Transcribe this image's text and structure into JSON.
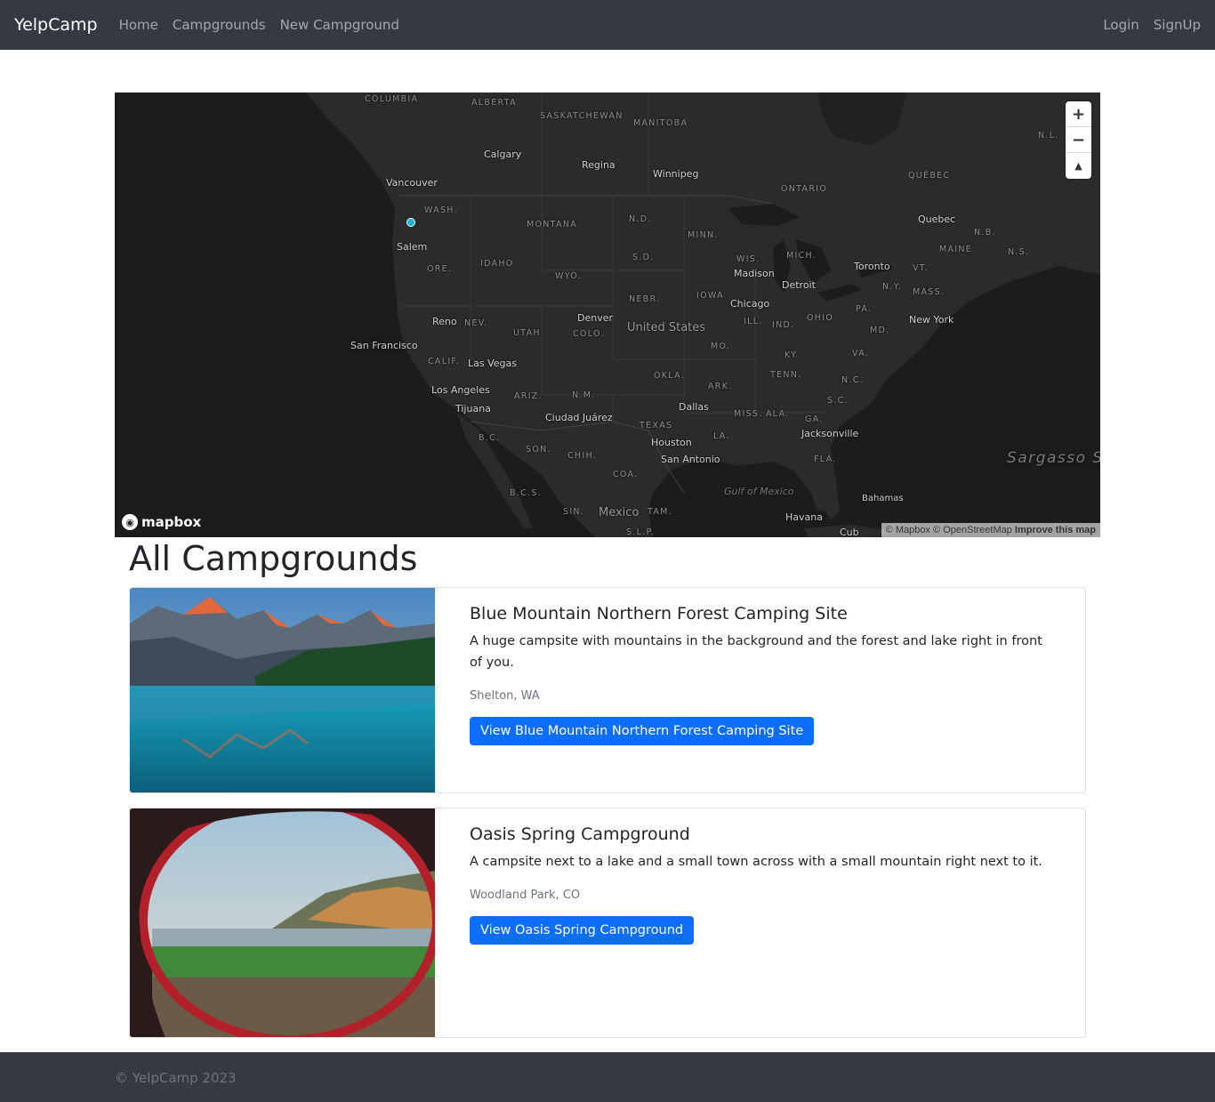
{
  "navbar": {
    "brand": "YelpCamp",
    "links": [
      "Home",
      "Campgrounds",
      "New Campground"
    ],
    "auth": [
      "Login",
      "SignUp"
    ]
  },
  "map": {
    "controls": {
      "zoom_in": "+",
      "zoom_out": "−",
      "compass": "▲"
    },
    "logo": "mapbox",
    "attribution": {
      "text": "© Mapbox © OpenStreetMap",
      "improve": "Improve this map"
    },
    "marker_color": "#11b4da",
    "labels": {
      "columbia": "COLUMBIA",
      "alberta": "ALBERTA",
      "saskatchewan": "SASKATCHEWAN",
      "manitoba": "MANITOBA",
      "calgary": "Calgary",
      "regina": "Regina",
      "winnipeg": "Winnipeg",
      "ontario": "ONTARIO",
      "quebec_prov": "QUÉBEC",
      "nl": "N.L.",
      "vancouver": "Vancouver",
      "wash": "WASH.",
      "montana": "MONTANA",
      "nd": "N.D.",
      "minn": "MINN.",
      "quebec": "Quebec",
      "nb": "N.B.",
      "salem": "Salem",
      "idaho": "IDAHO",
      "ore": "ORE.",
      "sd": "S.D.",
      "wis": "WIS.",
      "mich": "MICH.",
      "maine": "MAINE",
      "ns": "N.S.",
      "wyo": "WYO.",
      "madison": "Madison",
      "toronto": "Toronto",
      "vt": "VT.",
      "detroit": "Detroit",
      "ny": "N.Y.",
      "mass": "MASS.",
      "nebr": "NEBR.",
      "iowa": "IOWA",
      "chicago": "Chicago",
      "pa": "PA.",
      "denver": "Denver",
      "reno": "Reno",
      "nev": "NEV.",
      "ohio": "OHIO",
      "new_york": "New York",
      "utah": "UTAH",
      "colo": "COLO.",
      "united_states": "United States",
      "ill": "ILL.",
      "ind": "IND.",
      "md": "MD.",
      "san_francisco": "San Francisco",
      "mo": "MO.",
      "calif": "CALIF.",
      "las_vegas": "Las Vegas",
      "ky": "KY.",
      "va": "VA.",
      "okla": "OKLA.",
      "tenn": "TENN.",
      "los_angeles": "Los Angeles",
      "ariz": "ARIZ.",
      "nm": "N.M.",
      "ark": "ARK.",
      "nc": "N.C.",
      "tijuana": "Tijuana",
      "dallas": "Dallas",
      "sc": "S.C.",
      "miss": "MISS.",
      "ala": "ALA.",
      "ciudad_juarez": "Ciudad Juárez",
      "ga": "GA.",
      "texas": "TEXAS",
      "bc": "B.C.",
      "la": "LA.",
      "jacksonville": "Jacksonville",
      "houston": "Houston",
      "son": "SON.",
      "sargasso": "Sargasso Sea",
      "chih": "CHIH.",
      "san_antonio": "San Antonio",
      "fla": "FLA.",
      "coa": "COA.",
      "gulf": "Gulf of Mexico",
      "bcs": "B.C.S.",
      "bahamas": "Bahamas",
      "sin": "SIN.",
      "mexico": "Mexico",
      "tam": "TAM.",
      "havana": "Havana",
      "slp": "S.L.P.",
      "cuba": "Cub"
    }
  },
  "page": {
    "title": "All Campgrounds"
  },
  "campgrounds": [
    {
      "title": "Blue Mountain Northern Forest Camping Site",
      "description": "A huge campsite with mountains in the background and the forest and lake right in front of you.",
      "location": "Shelton, WA",
      "button": "View Blue Mountain Northern Forest Camping Site"
    },
    {
      "title": "Oasis Spring Campground",
      "description": "A campsite next to a lake and a small town across with a small mountain right next to it.",
      "location": "Woodland Park, CO",
      "button": "View Oasis Spring Campground"
    }
  ],
  "footer": {
    "text": "© YelpCamp 2023"
  }
}
